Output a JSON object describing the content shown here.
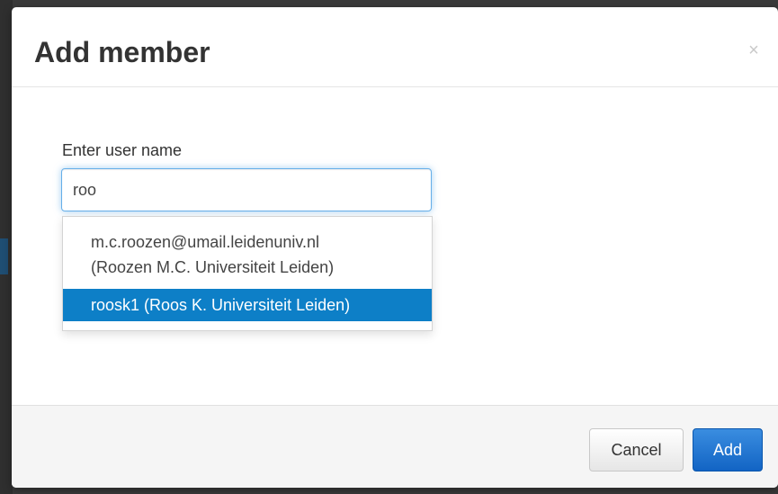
{
  "dialog": {
    "title": "Add member",
    "close_glyph": "×",
    "close_icon": "close-icon"
  },
  "form": {
    "label": "Enter user name",
    "input_value": "roo"
  },
  "autocomplete": {
    "options": [
      {
        "line1": "m.c.roozen@umail.leidenuniv.nl",
        "line2": "(Roozen M.C. Universiteit Leiden)",
        "selected": false
      },
      {
        "line1": "roosk1 (Roos K. Universiteit Leiden)",
        "selected": true
      }
    ],
    "highlight_color": "#0d7fc7"
  },
  "footer": {
    "cancel_label": "Cancel",
    "add_label": "Add"
  },
  "colors": {
    "primary": "#1264c4",
    "focus_border": "#66afe9",
    "backdrop": "#3a3a3a"
  }
}
